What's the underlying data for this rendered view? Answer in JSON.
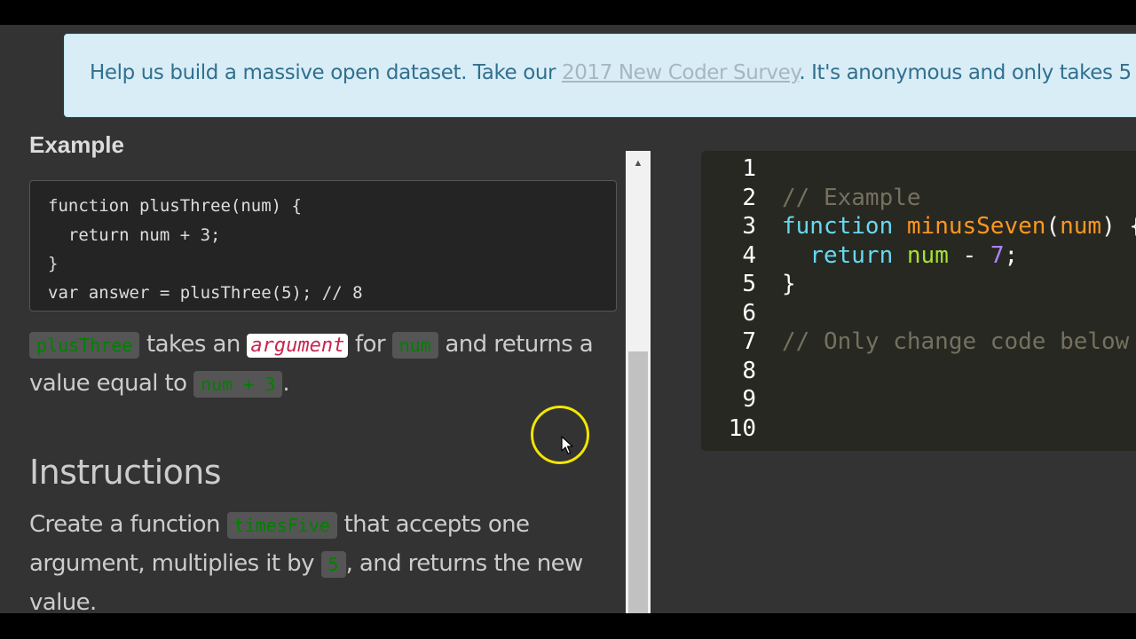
{
  "banner": {
    "text_before": "Help us build a massive open dataset. Take our ",
    "link": "2017 New Coder Survey",
    "text_after": ". It's anonymous and only takes 5"
  },
  "lesson": {
    "example_heading": "Example",
    "example_code": "function plusThree(num) {\n  return num + 3;\n}\nvar answer = plusThree(5); // 8",
    "desc": {
      "code1": "plusThree",
      "t1": " takes an ",
      "em": "argument",
      "t2": " for ",
      "code2": "num",
      "t3": " and returns a value equal to ",
      "code3": "num + 3",
      "t4": "."
    },
    "instructions_heading": "Instructions",
    "instructions": {
      "t1": "Create a function ",
      "code1": "timesFive",
      "t2": " that accepts one argument, multiplies it by ",
      "code2": "5",
      "t3": ", and returns the new value."
    }
  },
  "editor": {
    "line_numbers": [
      "1",
      "2",
      "3",
      "4",
      "5",
      "6",
      "7",
      "8",
      "9",
      "10"
    ],
    "line2": "// Example",
    "line3_kw": "function",
    "line3_fn": "minusSeven",
    "line3_open": "(",
    "line3_param": "num",
    "line3_rest": ") {",
    "line4_kw": "return",
    "line4_var": "num",
    "line4_op": " - ",
    "line4_num": "7",
    "line4_end": ";",
    "line5": "}",
    "line7": "// Only change code below this line"
  },
  "icons": {
    "scroll_up": "arrow-up-icon",
    "cursor": "mouse-pointer-icon"
  },
  "colors": {
    "banner_bg": "#d9edf7",
    "code_chip_text": "#008000",
    "em_chip_text": "#c7254e",
    "cursor_highlight": "#f2e600"
  }
}
